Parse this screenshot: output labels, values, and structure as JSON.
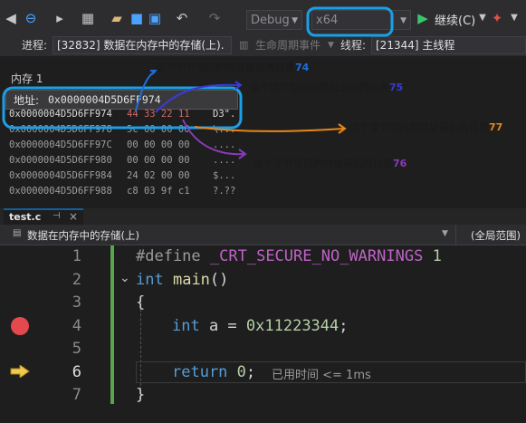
{
  "toolbar": {
    "config": "Debug",
    "platform": "x64",
    "continue_label": "继续(C)"
  },
  "process_bar": {
    "process_label": "进程:",
    "process_value": "[32832] 数据在内存中的存储(上).",
    "lifecycle_label": "生命周期事件",
    "thread_label": "线程:",
    "thread_value": "[21344] 主线程"
  },
  "memory": {
    "title": "内存 1",
    "address_label": "地址:",
    "address_value": "0x0000004D5D6FF974",
    "rows": [
      {
        "addr": "0x0000004D5D6FF974",
        "bytes": "44 33 22 11",
        "ascii": "D3\"."
      },
      {
        "addr": "0x0000004D5D6FF978",
        "bytes": "5c 00 00 00",
        "ascii": "\\..."
      },
      {
        "addr": "0x0000004D5D6FF97C",
        "bytes": "00 00 00 00",
        "ascii": "...."
      },
      {
        "addr": "0x0000004D5D6FF980",
        "bytes": "00 00 00 00",
        "ascii": "...."
      },
      {
        "addr": "0x0000004D5D6FF984",
        "bytes": "24 02 00 00",
        "ascii": "$..."
      },
      {
        "addr": "0x0000004D5D6FF988",
        "bytes": "c8 03 9f c1",
        "ascii": "?.??"
      }
    ]
  },
  "annotations": {
    "prefix": "这个字节空间的地址最后两位是",
    "n74": "74",
    "n75": "75",
    "n77": "77",
    "n76": "76",
    "c74": "#1e6fd9",
    "c75": "#3a3ad9",
    "c77": "#e8861a",
    "c76": "#8a3ab9"
  },
  "editor": {
    "tab_name": "test.c",
    "scope_left": "数据在内存中的存储(上)",
    "scope_right": "(全局范围)",
    "lines": [
      {
        "n": "1",
        "text": "#define _CRT_SECURE_NO_WARNINGS 1"
      },
      {
        "n": "2",
        "text": "int main()"
      },
      {
        "n": "3",
        "text": "{"
      },
      {
        "n": "4",
        "text": "int a = 0x11223344;"
      },
      {
        "n": "5",
        "text": ""
      },
      {
        "n": "6",
        "text": "return 0;"
      },
      {
        "n": "7",
        "text": "}"
      }
    ],
    "elapsed": "已用时间 <= 1ms"
  }
}
